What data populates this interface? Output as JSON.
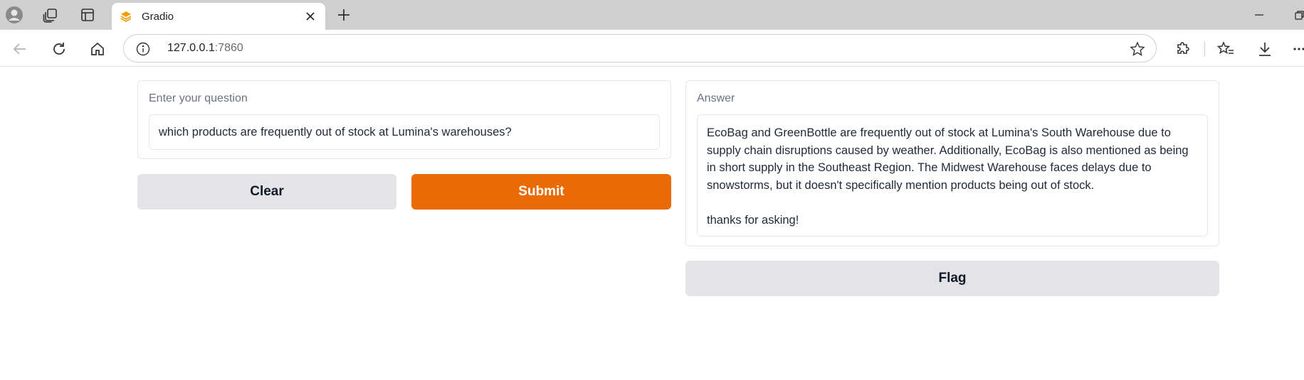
{
  "browser": {
    "tab_title": "Gradio",
    "new_tab": "+",
    "url_host": "127.0.0.1",
    "url_port": ":7860"
  },
  "question": {
    "label": "Enter your question",
    "value": "which products are frequently out of stock at Lumina's warehouses?"
  },
  "buttons": {
    "clear": "Clear",
    "submit": "Submit",
    "flag": "Flag"
  },
  "answer": {
    "label": "Answer",
    "value": "EcoBag and GreenBottle are frequently out of stock at Lumina's South Warehouse due to supply chain disruptions caused by weather. Additionally, EcoBag is also mentioned as being in short supply in the Southeast Region. The Midwest Warehouse faces delays due to snowstorms, but it doesn't specifically mention products being out of stock.\n\nthanks for asking!"
  },
  "colors": {
    "primary": "#ea6b06",
    "secondary": "#e4e4e7",
    "tabbar": "#cfcfcf"
  }
}
